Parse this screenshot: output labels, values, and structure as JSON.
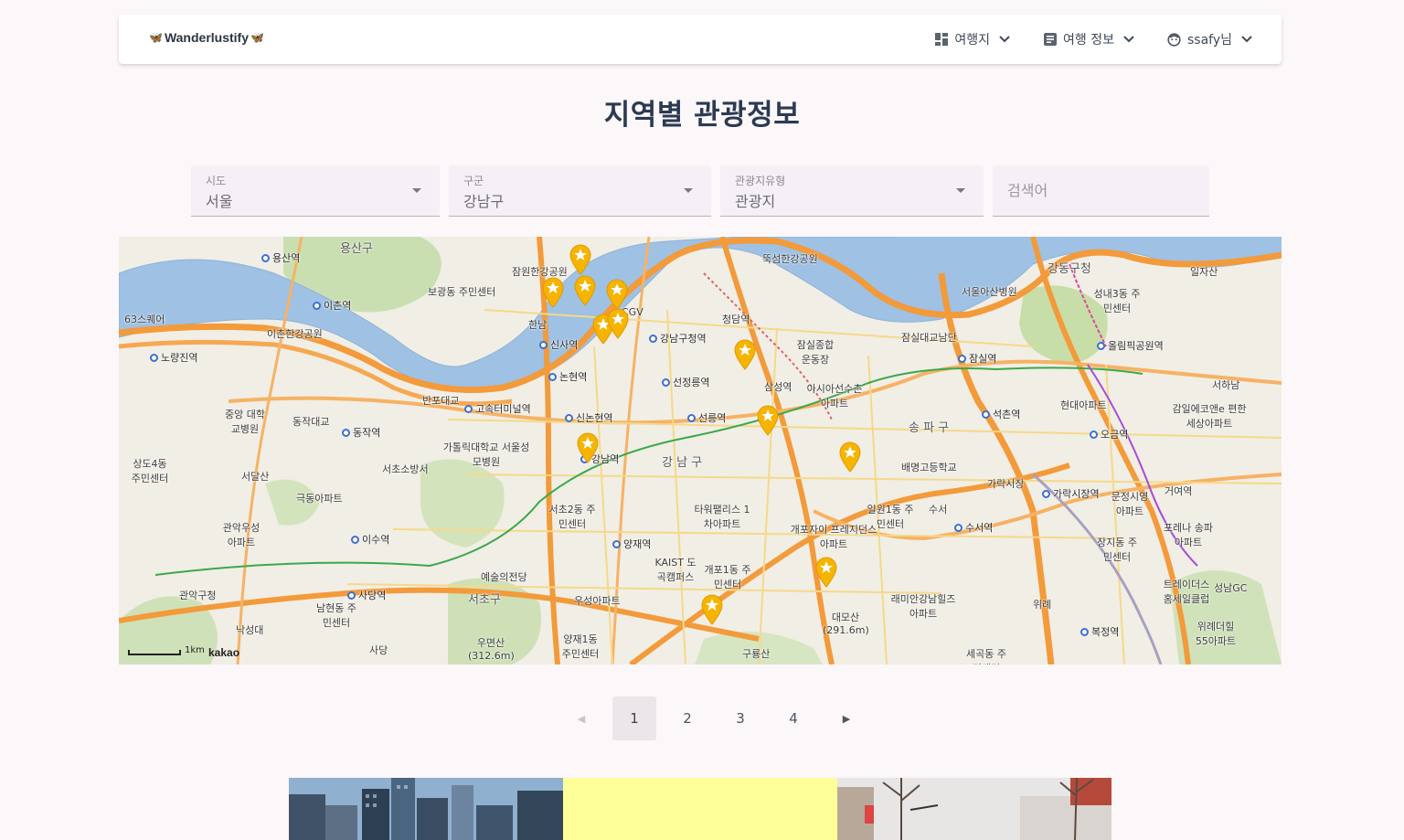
{
  "brand": {
    "name": "Wanderlustify"
  },
  "nav": {
    "items": [
      {
        "label": "여행지",
        "icon": "dashboard-icon"
      },
      {
        "label": "여행 정보",
        "icon": "article-icon"
      },
      {
        "label": "ssafy님",
        "icon": "face-icon"
      }
    ]
  },
  "page": {
    "title": "지역별 관광정보"
  },
  "filters": {
    "sido": {
      "label": "시도",
      "value": "서울"
    },
    "gugun": {
      "label": "구군",
      "value": "강남구"
    },
    "type": {
      "label": "관광지유형",
      "value": "관광지"
    },
    "search": {
      "placeholder": "검색어"
    }
  },
  "map": {
    "scale_label": "1km",
    "provider": "kakao",
    "labels": [
      "용산구",
      "용산역",
      "보광동 주민센터",
      "이촌역",
      "63스퀘어",
      "이촌한강공원",
      "노량진역",
      "중앙 대학교병원",
      "동작대교",
      "동작역",
      "반포대교",
      "고속터미널역",
      "가톨릭대학교 서울성모병원",
      "서초소방서",
      "상도4동 주민센터",
      "서달산",
      "극동아파트",
      "관악우성 아파트",
      "이수역",
      "사당역",
      "관악구청",
      "남현동 주민센터",
      "낙성대",
      "사당",
      "서초구",
      "예술의전당",
      "우면산 (312.6m)",
      "서초2동 주민센터",
      "양재역",
      "우성아파트",
      "양재1동 주민센터",
      "KAIST 도곡캠퍼스",
      "타워팰리스 1차아파트",
      "개포1동 주민센터",
      "구룡산",
      "개포자이 프레지던스아파트",
      "대모산 (291.6m)",
      "일원1동 주민센터",
      "래미안강남힐즈 아파트",
      "세곡동 주민센터",
      "강남역",
      "신논현역",
      "논현역",
      "신사역",
      "한남",
      "잠원한강공원",
      "CGV",
      "강남구청역",
      "선정릉역",
      "선릉역",
      "강 남 구",
      "청담역",
      "잠실종합 운동장",
      "아시아선수촌 아파트",
      "삼성역",
      "잠실대교남단",
      "잠실역",
      "송 파 구",
      "배명고등학교",
      "석촌역",
      "수서",
      "수서역",
      "가락시장",
      "가락시장역",
      "문정시영 아파트",
      "장지동 주민센터",
      "포레나 송파아파트",
      "트레이더스 홈세일클럽",
      "위례",
      "복정역",
      "위례더힐 55아파트",
      "성남GC",
      "서울아산병원",
      "강동구청",
      "성내3동 주민센터",
      "올림픽공원역",
      "서하남",
      "감일에코앤e 편한세상아파트",
      "현대아파트",
      "오금역",
      "거여역",
      "일자산",
      "뚝섬한강공원"
    ]
  },
  "pagination": {
    "pages": [
      "1",
      "2",
      "3",
      "4"
    ],
    "current": "1",
    "prev_icon": "chevron-left-icon",
    "next_icon": "chevron-right-icon"
  },
  "colors": {
    "accent": "#2c3a52",
    "marker": "#f6b400",
    "river": "#8fb6dd",
    "road": "#f28c2b"
  }
}
